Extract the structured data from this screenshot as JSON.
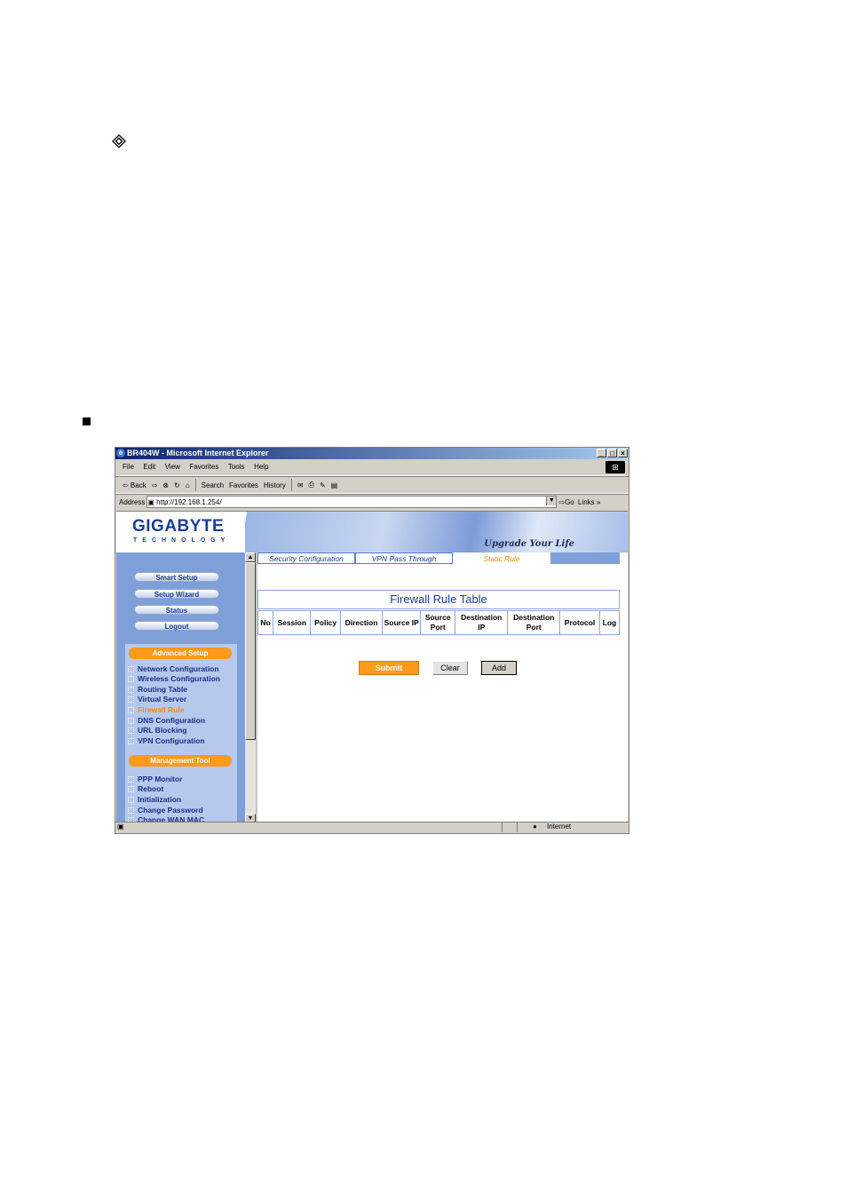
{
  "doc": {
    "diamond_icon": "diamond-bullet-icon",
    "square_icon": "square-bullet-icon"
  },
  "browser": {
    "title": "BR404W - Microsoft Internet Explorer",
    "window_buttons": [
      "_",
      "□",
      "×"
    ],
    "menu": [
      "File",
      "Edit",
      "View",
      "Favorites",
      "Tools",
      "Help"
    ],
    "toolbar": {
      "back": "⇦ Back",
      "forward": "⇨",
      "search": "Search",
      "favorites": "Favorites",
      "history": "History"
    },
    "address_label": "Address",
    "address_value": "http://192.168.1.254/",
    "go": "Go",
    "links": "Links",
    "status_zone": "Internet"
  },
  "header": {
    "logo": "GIGABYTE",
    "logo_tm": "TM",
    "logo_sub": "TECHNOLOGY",
    "tagline": "Upgrade Your Life"
  },
  "sidebar": {
    "top_buttons": [
      "Smart Setup",
      "Setup Wizard",
      "Status",
      "Logout"
    ],
    "advanced_title": "Advanced Setup",
    "advanced_items": [
      "Network Configuration",
      "Wireless Configuration",
      "Routing Table",
      "Virtual Server",
      "Firewall Rule",
      "DNS Configuration",
      "URL Blocking",
      "VPN Configuration"
    ],
    "active_item": "Firewall Rule",
    "management_title": "Management Tool",
    "management_items": [
      "PPP Monitor",
      "Reboot",
      "Initialization",
      "Change Password",
      "Change WAN MAC"
    ]
  },
  "tabs": [
    "Security Configuration",
    "VPN Pass Through",
    "Static Rule"
  ],
  "active_tab": "Static Rule",
  "firewall": {
    "title": "Firewall Rule Table",
    "columns": [
      "No",
      "Session",
      "Policy",
      "Direction",
      "Source IP",
      "Source Port",
      "Destination IP",
      "Destination Port",
      "Protocol",
      "Log"
    ]
  },
  "buttons": {
    "submit": "Submit",
    "clear": "Clear",
    "add": "Add"
  },
  "colors": {
    "accent_orange": "#ff9a1a",
    "nav_blue": "#1b3f96",
    "sidebar_blue": "#7f9fd8"
  }
}
